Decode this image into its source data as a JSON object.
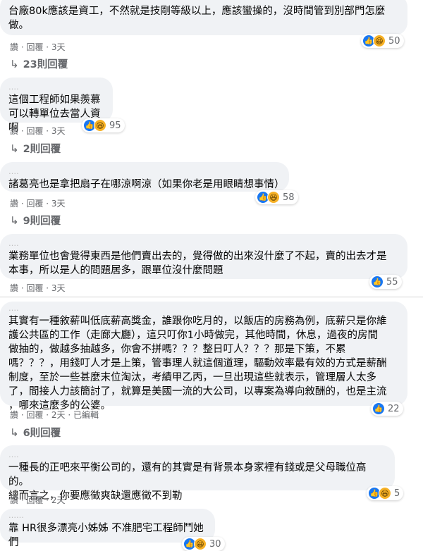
{
  "comments": [
    {
      "text": "台廠80k應該是資工，不然就是技剛等級以上，應該蠻操的，沒時間管到別部門怎麼\n做。",
      "actions": "讚 · 回覆 · 3天",
      "reaction_count": "50",
      "reaction_icons": [
        "like-icon",
        "haha-icon"
      ],
      "replies": "23則回覆"
    },
    {
      "text": "這個工程師如果羨慕\n可以轉單位去當人資啊",
      "actions": "讚 · 回覆 · 3天",
      "reaction_count": "95",
      "reaction_icons": [
        "like-icon",
        "haha-icon"
      ],
      "replies": "2則回覆"
    },
    {
      "text": "諸葛亮也是拿把扇子在哪涼啊涼（如果你老是用眼睛想事情）",
      "actions": "讚 · 回覆 · 3天",
      "reaction_count": "58",
      "reaction_icons": [
        "like-icon",
        "haha-icon"
      ],
      "replies": "9則回覆"
    },
    {
      "text": "業務單位也會覺得東西是他們賣出去的，覺得做的出來沒什麼了不起，賣的出去才是\n本事，所以是人的問題居多，跟單位沒什麼問題",
      "actions": "讚 · 回覆 · 3天",
      "reaction_count": "55",
      "reaction_icons": [
        "like-icon"
      ],
      "replies": ""
    },
    {
      "text": "其實有一種敘薪叫低底薪高獎金，誰跟你吃月的，以飯店的房務為例，底薪只是你維\n護公共區的工作（走廊大廳），這只叮你1小時做完，其他時間，休息，過夜的房間\n做抽的，做越多抽越多，你會不拼嗎？？？整日叮人？？？那是下策，不累\n嗎？？？，用錢叮人才是上策，管事理人就這個道理，驅動效率最有效的方式是薪酬\n制度，至於一些甚麼末位淘汰，考績甲乙丙，一旦出現這些就表示，管理層人太多\n了，間接人力該簡討了，就算是美國一流的大公司，以專案為導向敘酬的，也是主流\n，哪來這麼多的公婆。",
      "actions": "讚 · 回覆 · 2天 · 已編輯",
      "reaction_count": "22",
      "reaction_icons": [
        "like-icon"
      ],
      "replies": "6則回覆"
    },
    {
      "text": "一種長的正吧來平衡公司的，還有的其實是有背景本身家裡有錢或是父母職位高的。\n總而言之，你要應徵爽缺還應徵不到勒",
      "actions": "讚 · 回覆 · 2天",
      "reaction_count": "5",
      "reaction_icons": [
        "like-icon",
        "haha-icon"
      ],
      "replies": ""
    },
    {
      "text": "靠 HR很多漂亮小姊姊 不准肥宅工程師鬥她們",
      "actions": "",
      "reaction_count": "30",
      "reaction_icons": [
        "like-icon",
        "haha-icon"
      ],
      "replies": ""
    }
  ]
}
